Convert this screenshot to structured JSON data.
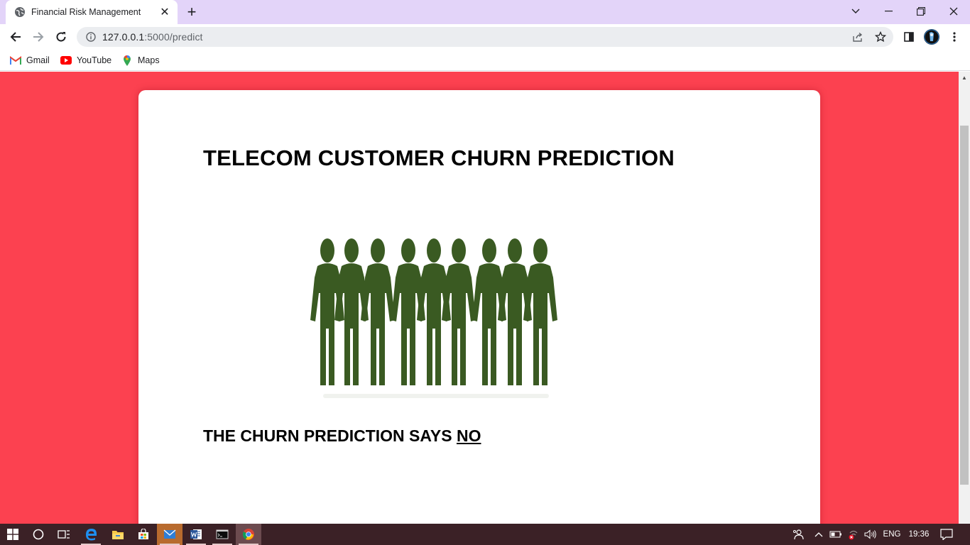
{
  "browser": {
    "tab_title": "Financial Risk Management",
    "tab_close": "✕",
    "new_tab": "+",
    "url_host": "127.0.0.1",
    "url_path": ":5000/predict",
    "bookmarks": [
      {
        "label": "Gmail",
        "icon": "gmail-icon"
      },
      {
        "label": "YouTube",
        "icon": "youtube-icon"
      },
      {
        "label": "Maps",
        "icon": "maps-icon"
      }
    ]
  },
  "page": {
    "heading": "TELECOM CUSTOMER CHURN PREDICTION",
    "result_prefix": "THE CHURN PREDICTION SAYS ",
    "result_value": "NO",
    "background_color": "#fc4150",
    "figure_color": "#3a5a22"
  },
  "taskbar": {
    "language": "ENG",
    "time": "19:36"
  }
}
